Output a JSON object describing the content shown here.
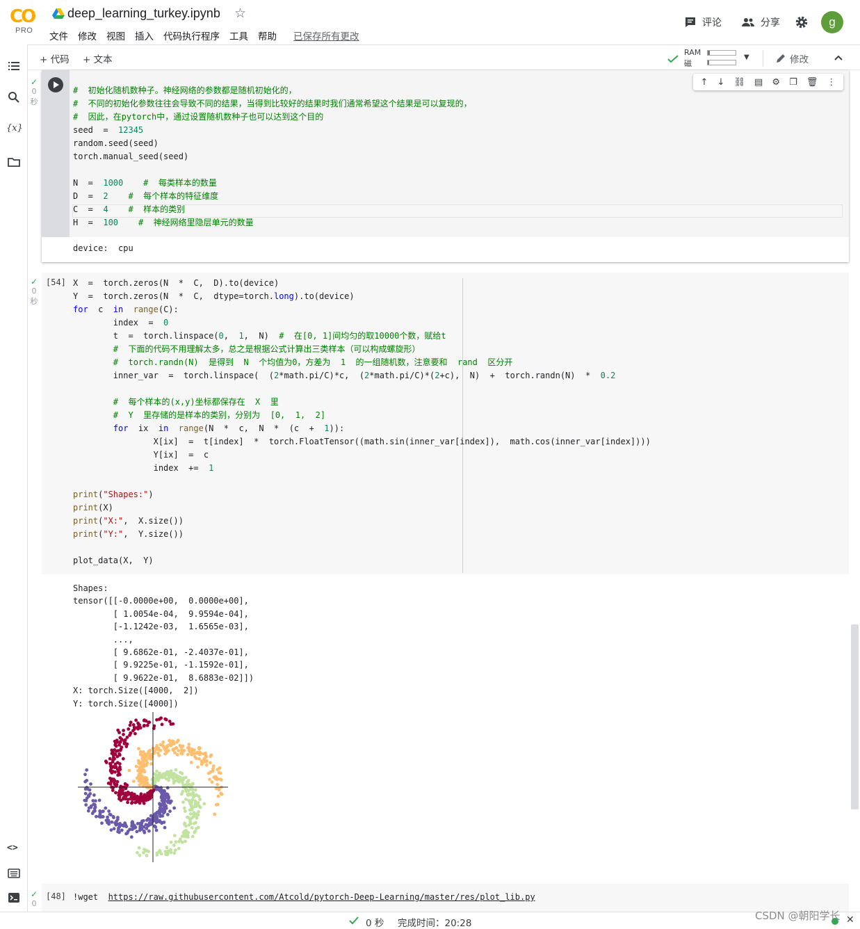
{
  "header": {
    "logo_text": "CO",
    "logo_sub": "PRO",
    "title": "deep_learning_turkey.ipynb",
    "menu": [
      "文件",
      "修改",
      "视图",
      "插入",
      "代码执行程序",
      "工具",
      "帮助"
    ],
    "saved_status": "已保存所有更改",
    "comment_label": "评论",
    "share_label": "分享",
    "avatar_letter": "g"
  },
  "toolbar": {
    "add_code": "+ 代码",
    "add_text": "+ 文本",
    "ram_label": "RAM",
    "disk_label": "磁盘",
    "ram_usage": 0.07,
    "disk_usage": 0.05,
    "edit_label": "修改"
  },
  "cell1": {
    "status_time": "0",
    "status_unit": "秒",
    "output": "device:  cpu"
  },
  "cell2": {
    "exec_count": "[54]",
    "status_time": "0",
    "status_unit": "秒",
    "output_text": "Shapes:\ntensor([[-0.0000e+00,  0.0000e+00],\n        [ 1.0054e-04,  9.9594e-04],\n        [-1.1242e-03,  1.6565e-03],\n        ...,\n        [ 9.6862e-01, -2.4037e-01],\n        [ 9.9225e-01, -1.1592e-01],\n        [ 9.9622e-01,  8.6883e-02]])\nX: torch.Size([4000,  2])\nY: torch.Size([4000])"
  },
  "cell3": {
    "exec_count": "[48]",
    "status_time": "0",
    "cmd": "!wget",
    "url": "https://raw.githubusercontent.com/Atcold/pytorch-Deep-Learning/master/res/plot_lib.py"
  },
  "statusbar": {
    "time": "0 秒",
    "finished": "完成时间：20:28"
  },
  "watermark": "CSDN @朝阳学长",
  "colors": {
    "class0": "#c2e2a0",
    "class1": "#6b5aab",
    "class2": "#a0003c",
    "class3": "#fdbf6f",
    "ok_green": "#34a853"
  }
}
